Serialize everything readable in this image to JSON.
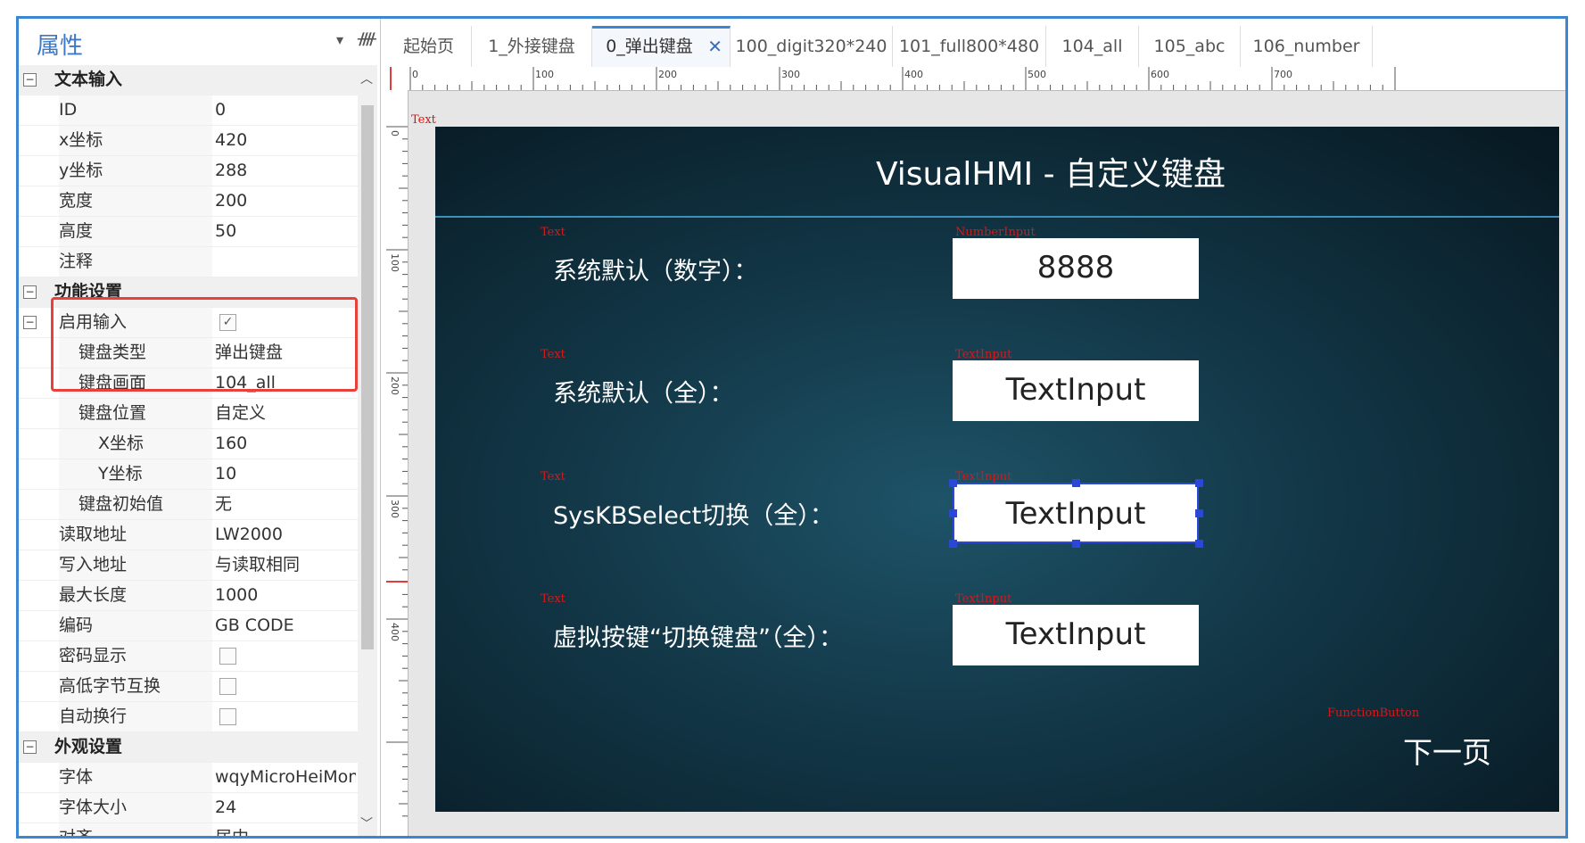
{
  "props": {
    "title": "属性",
    "rows": [
      {
        "kind": "cat",
        "label": "文本输入",
        "toggle": "−"
      },
      {
        "label": "ID",
        "value": "0"
      },
      {
        "label": "x坐标",
        "value": "420"
      },
      {
        "label": "y坐标",
        "value": "288"
      },
      {
        "label": "宽度",
        "value": "200"
      },
      {
        "label": "高度",
        "value": "50"
      },
      {
        "label": "注释",
        "value": ""
      },
      {
        "kind": "cat",
        "label": "功能设置",
        "toggle": "−"
      },
      {
        "label": "启用输入",
        "check": true,
        "toggle": "−"
      },
      {
        "label": "键盘类型",
        "value": "弹出键盘",
        "lvl": 2
      },
      {
        "label": "键盘画面",
        "value": "104_all",
        "lvl": 2
      },
      {
        "label": "键盘位置",
        "value": "自定义",
        "lvl": 2,
        "toggle": "−"
      },
      {
        "label": "X坐标",
        "value": "160",
        "lvl": 3
      },
      {
        "label": "Y坐标",
        "value": "10",
        "lvl": 3
      },
      {
        "label": "键盘初始值",
        "value": "无",
        "lvl": 2
      },
      {
        "label": "读取地址",
        "value": "LW2000"
      },
      {
        "label": "写入地址",
        "value": "与读取相同"
      },
      {
        "label": "最大长度",
        "value": "1000"
      },
      {
        "label": "编码",
        "value": "GB CODE"
      },
      {
        "label": "密码显示",
        "check": false
      },
      {
        "label": "高低字节互换",
        "check": false
      },
      {
        "label": "自动换行",
        "check": false
      },
      {
        "kind": "cat",
        "label": "外观设置",
        "toggle": "−"
      },
      {
        "label": "字体",
        "value": "wqyMicroHeiMono"
      },
      {
        "label": "字体大小",
        "value": "24"
      },
      {
        "label": "对齐",
        "value": "居中"
      }
    ]
  },
  "tabs": [
    {
      "label": "起始页"
    },
    {
      "label": "1_外接键盘"
    },
    {
      "label": "0_弹出键盘",
      "active": true
    },
    {
      "label": "100_digit320*240"
    },
    {
      "label": "101_full800*480"
    },
    {
      "label": "104_all"
    },
    {
      "label": "105_abc"
    },
    {
      "label": "106_number"
    }
  ],
  "ruler": {
    "h_labels": [
      "0",
      "100",
      "200",
      "300",
      "400",
      "500",
      "600",
      "700"
    ],
    "v_labels": [
      "0",
      "100",
      "200",
      "300",
      "400"
    ]
  },
  "canvas": {
    "top_tag": "Text",
    "title": "VisualHMI - 自定义键盘",
    "rows": [
      {
        "label_tag": "Text",
        "label": "系统默认（数字）：",
        "input_tag": "NumberInput",
        "input": "8888"
      },
      {
        "label_tag": "Text",
        "label": "系统默认（全）：",
        "input_tag": "TextInput",
        "input": "TextInput"
      },
      {
        "label_tag": "Text",
        "label": "SysKBSelect切换（全）：",
        "input_tag": "TextInput",
        "input": "TextInput",
        "selected": true
      },
      {
        "label_tag": "Text",
        "label": "虚拟按键“切换键盘”（全）：",
        "input_tag": "TextInput",
        "input": "TextInput"
      }
    ],
    "function_tag": "FunctionButton",
    "next_button": "下一页"
  },
  "colors": {
    "frame": "#3a86d2",
    "highlight": "#e8403a",
    "selection": "#2b47d6",
    "tag": "#d11a1a"
  }
}
